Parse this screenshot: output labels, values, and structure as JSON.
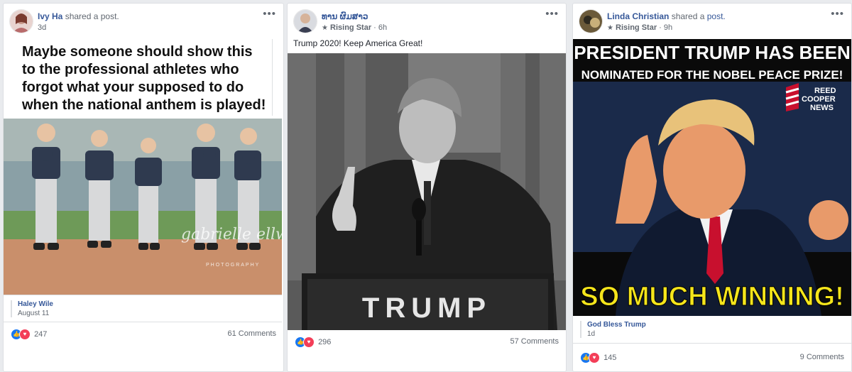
{
  "posts": [
    {
      "author": "Ivy Ha",
      "action": "shared a post.",
      "time": "3d",
      "image_text": "Maybe someone should show this to the professional athletes who forgot what your supposed to do when the national anthem is played!",
      "watermark": "gabrielle ellwood",
      "watermark_sub": "PHOTOGRAPHY",
      "source_name": "Haley Wile",
      "source_date": "August 11",
      "reactions": "247",
      "comments": "61 Comments"
    },
    {
      "author": "ທານ ຜົມສາວ",
      "badge": "Rising Star",
      "time": "6h",
      "text": "Trump 2020! Keep America Great!",
      "podium_text": "TRUMP",
      "reactions": "296",
      "comments": "57 Comments"
    },
    {
      "author": "Linda Christian",
      "action_prefix": "shared a",
      "action_link": "post.",
      "badge": "Rising Star",
      "time": "9h",
      "headline": "PRESIDENT TRUMP HAS BEEN",
      "subheadline": "NOMINATED FOR THE NOBEL PEACE PRIZE!",
      "logo_line1": "REED",
      "logo_line2": "COOPER",
      "logo_line3": "NEWS",
      "bottom_text": "SO MUCH WINNING!",
      "source_name": "God Bless Trump",
      "source_date": "1d",
      "reactions": "145",
      "comments": "9 Comments"
    }
  ],
  "ui": {
    "more_icon": "more-options-icon",
    "like_icon": "like-reaction-icon",
    "love_icon": "love-reaction-icon",
    "star_icon": "star-icon",
    "ellipsis": "•••",
    "star_glyph": "★",
    "separator": "·"
  },
  "colors": {
    "link": "#365899",
    "like": "#1877f2",
    "love": "#f33e58",
    "winning_yellow": "#f5e51b"
  }
}
